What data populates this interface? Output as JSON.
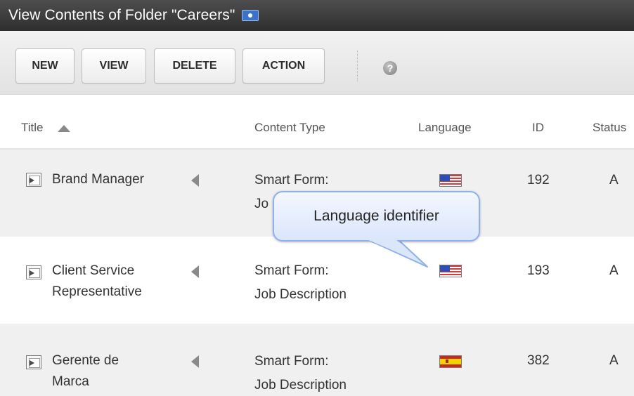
{
  "window": {
    "title": "View Contents of Folder \"Careers\"",
    "badge_icon": "folder-properties-icon"
  },
  "toolbar": {
    "new_label": "NEW",
    "view_label": "VIEW",
    "delete_label": "DELETE",
    "action_label": "ACTION",
    "help_icon": "help-icon",
    "help_glyph": "?"
  },
  "table": {
    "columns": [
      "Title",
      "Content Type",
      "Language",
      "ID",
      "Status"
    ],
    "sort_icon": "sort-ascending-icon",
    "rows": [
      {
        "title_line1": "Brand Manager",
        "title_line2": "",
        "type_line1": "Smart Form:",
        "type_line2": "Jo",
        "language_flag": "us-flag-icon",
        "id": "192",
        "status": "A"
      },
      {
        "title_line1": "Client Service",
        "title_line2": "Representative",
        "type_line1": "Smart Form:",
        "type_line2": "Job Description",
        "language_flag": "us-flag-icon",
        "id": "193",
        "status": "A"
      },
      {
        "title_line1": "Gerente de",
        "title_line2": "Marca",
        "type_line1": "Smart Form:",
        "type_line2": "Job Description",
        "language_flag": "spain-flag-icon",
        "id": "382",
        "status": "A"
      }
    ]
  },
  "callout": {
    "text": "Language identifier"
  },
  "colors": {
    "titlebar": "#3a3a3a",
    "callout_border": "#8fb0e8",
    "row_alt": "#f0f0f0",
    "badge": "#3c73c8"
  }
}
